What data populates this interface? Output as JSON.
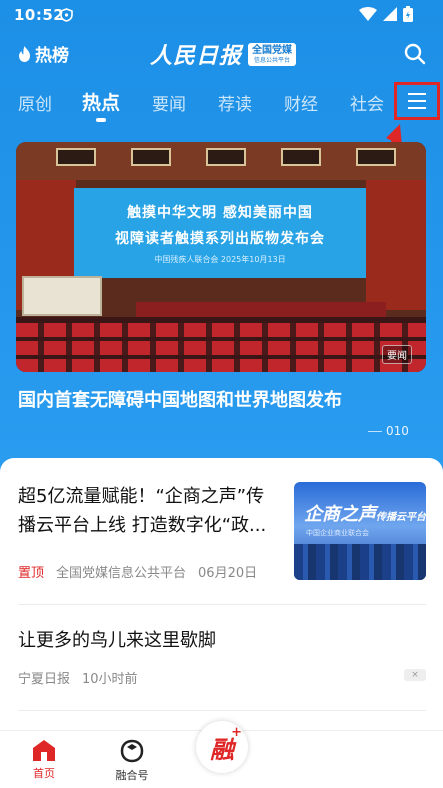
{
  "status_bar": {
    "time": "10:52"
  },
  "header": {
    "hot_rank_label": "热榜",
    "logo_text": "人民日报",
    "logo_badge": "全国党媒",
    "logo_badge_sub": "信息公共平台"
  },
  "tabs": [
    {
      "label": "原创",
      "active": false
    },
    {
      "label": "热点",
      "active": true
    },
    {
      "label": "要闻",
      "active": false
    },
    {
      "label": "荐读",
      "active": false
    },
    {
      "label": "财经",
      "active": false
    },
    {
      "label": "社会",
      "active": false
    }
  ],
  "hero": {
    "screen_line1": "触摸中华文明  感知美丽中国",
    "screen_line2": "视障读者触摸系列出版物发布会",
    "screen_sub": "中国残疾人联合会  2025年10月13日",
    "tag": "要闻",
    "title": "国内首套无障碍中国地图和世界地图发布",
    "pager": "010"
  },
  "news": [
    {
      "title": "超5亿流量赋能！“企商之声”传播云平台上线 打造数字化“政...",
      "pin": "置顶",
      "source": "全国党媒信息公共平台",
      "date": "06月20日",
      "thumb_title": "企商之声",
      "thumb_title_suffix": "传播云平台",
      "thumb_sub": "中国企业商业联合会"
    },
    {
      "title": "让更多的鸟儿来这里歇脚",
      "source": "宁夏日报",
      "date": "10小时前",
      "close": "×"
    }
  ],
  "bottom_nav": {
    "home": "首页",
    "fusion_center": "融",
    "fusion_plus": "+",
    "fusion_account": "融合号"
  },
  "colors": {
    "brand_blue": "#2196e8",
    "accent_red": "#e02727"
  }
}
